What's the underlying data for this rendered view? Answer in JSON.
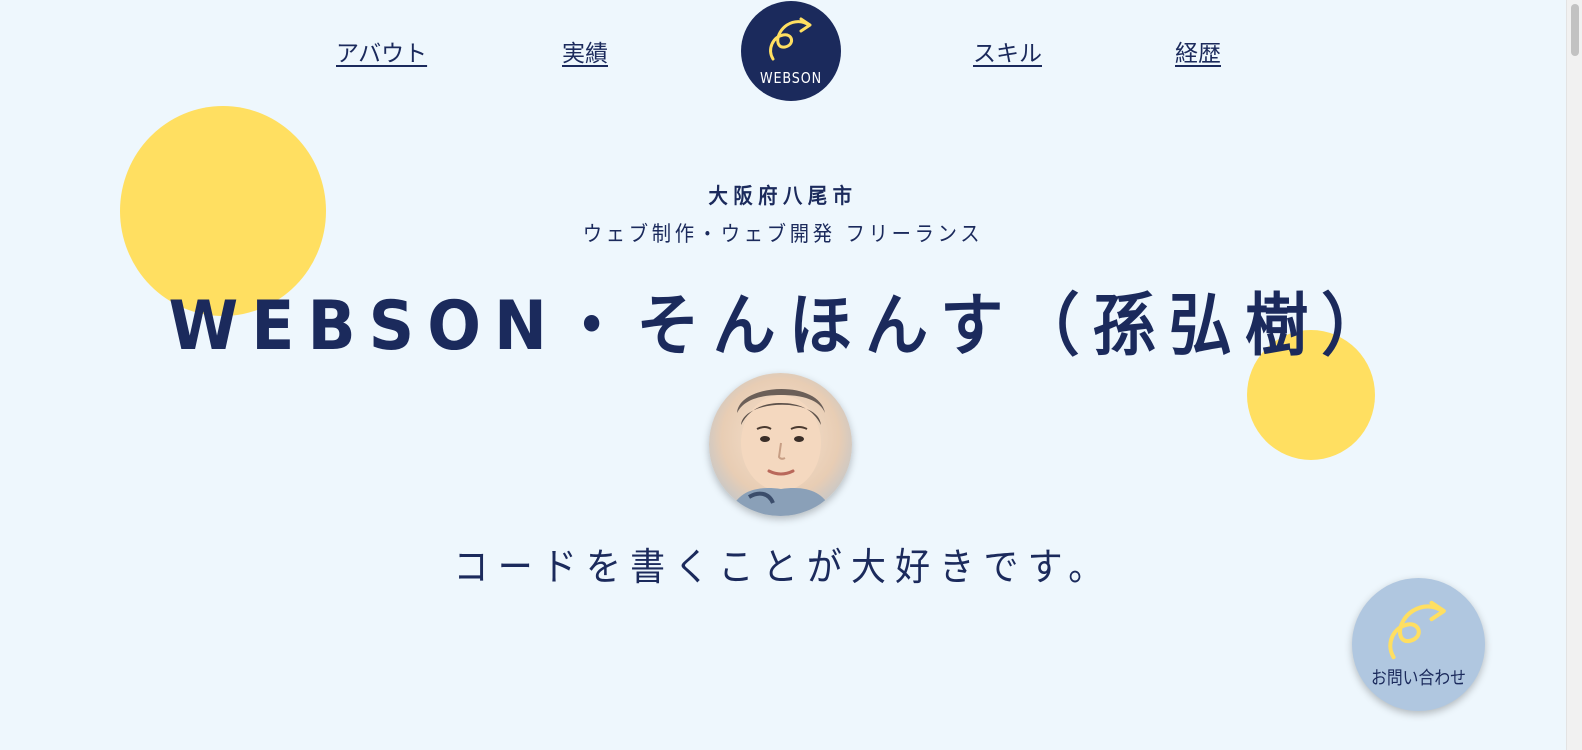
{
  "nav": {
    "items": [
      {
        "label": "アバウト"
      },
      {
        "label": "実績"
      },
      {
        "label": "スキル"
      },
      {
        "label": "経歴"
      }
    ],
    "logo_text": "WEBSON"
  },
  "hero": {
    "location": "大阪府八尾市",
    "role": "ウェブ制作・ウェブ開発 フリーランス",
    "name": "WEBSON・そんほんす（孫弘樹）",
    "tagline": "コードを書くことが大好きです。"
  },
  "contact": {
    "label": "お問い合わせ"
  },
  "colors": {
    "background": "#eef7fd",
    "navy": "#1b2a5c",
    "yellow": "#ffdf61",
    "contact_bg": "#b0c7e0"
  },
  "icons": {
    "logo": "curl-arrow-icon",
    "contact": "curl-arrow-icon"
  }
}
